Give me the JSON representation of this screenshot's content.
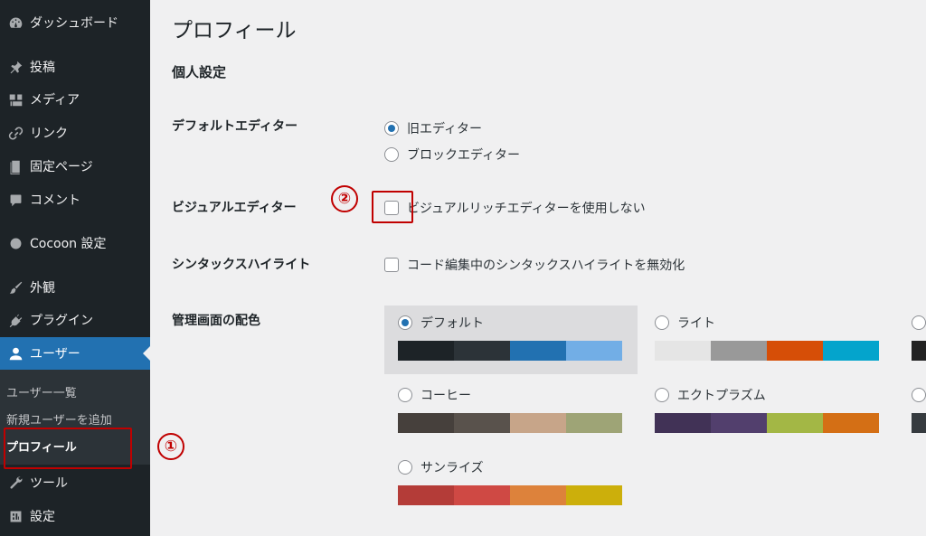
{
  "sidebar": {
    "items": [
      {
        "label": "ダッシュボード",
        "icon": "dashboard-icon"
      },
      {
        "label": "投稿",
        "icon": "pin-icon"
      },
      {
        "label": "メディア",
        "icon": "media-icon"
      },
      {
        "label": "リンク",
        "icon": "link-icon"
      },
      {
        "label": "固定ページ",
        "icon": "page-icon"
      },
      {
        "label": "コメント",
        "icon": "comment-icon"
      },
      {
        "label": "Cocoon 設定",
        "icon": "circle-icon"
      },
      {
        "label": "外観",
        "icon": "brush-icon"
      },
      {
        "label": "プラグイン",
        "icon": "plugin-icon"
      },
      {
        "label": "ユーザー",
        "icon": "user-icon"
      },
      {
        "label": "ツール",
        "icon": "wrench-icon"
      },
      {
        "label": "設定",
        "icon": "settings-icon"
      }
    ],
    "submenu": [
      "ユーザー一覧",
      "新規ユーザーを追加",
      "プロフィール"
    ]
  },
  "page": {
    "title": "プロフィール",
    "section": "個人設定"
  },
  "default_editor": {
    "label": "デフォルトエディター",
    "options": [
      "旧エディター",
      "ブロックエディター"
    ],
    "selected": "旧エディター"
  },
  "visual_editor": {
    "label": "ビジュアルエディター",
    "checkbox_label": "ビジュアルリッチエディターを使用しない",
    "checked": false
  },
  "syntax_highlight": {
    "label": "シンタックスハイライト",
    "checkbox_label": "コード編集中のシンタックスハイライトを無効化",
    "checked": false
  },
  "color_scheme": {
    "label": "管理画面の配色",
    "selected": "デフォルト",
    "schemes": [
      {
        "name": "デフォルト",
        "colors": [
          "#1d2327",
          "#2c3338",
          "#2271b1",
          "#72aee6"
        ]
      },
      {
        "name": "ライト",
        "colors": [
          "#e5e5e5",
          "#999999",
          "#d64e07",
          "#04a4cc"
        ]
      },
      {
        "name": "コーヒー",
        "colors": [
          "#46403c",
          "#59524c",
          "#c7a589",
          "#9ea476"
        ]
      },
      {
        "name": "エクトプラズム",
        "colors": [
          "#413256",
          "#523f6d",
          "#a3b745",
          "#d46f15"
        ]
      },
      {
        "name": "サンライズ",
        "colors": [
          "#b43c38",
          "#cf4944",
          "#dd823b",
          "#ccaf0b"
        ]
      }
    ]
  },
  "annotations": [
    "①",
    "②"
  ],
  "colors": {
    "sidebar_bg": "#1d2327",
    "accent": "#2271b1",
    "annotation_red": "#c00000"
  }
}
